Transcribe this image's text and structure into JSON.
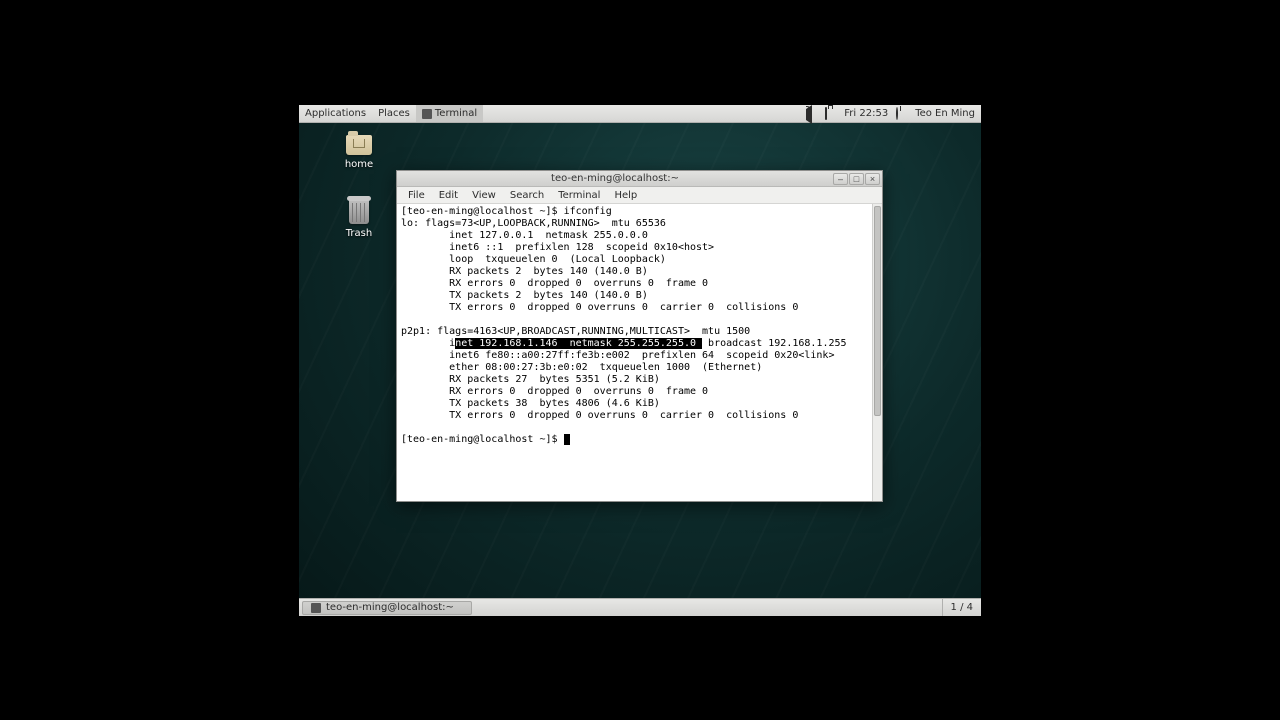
{
  "topbar": {
    "menus": {
      "applications": "Applications",
      "places": "Places"
    },
    "app_launcher": "Terminal",
    "clock": "Fri 22:53",
    "user": "Teo En Ming"
  },
  "desktop_icons": {
    "home": "home",
    "trash": "Trash"
  },
  "window": {
    "title": "teo-en-ming@localhost:~",
    "menus": {
      "file": "File",
      "edit": "Edit",
      "view": "View",
      "search": "Search",
      "terminal": "Terminal",
      "help": "Help"
    },
    "controls": {
      "min": "–",
      "max": "□",
      "close": "×"
    }
  },
  "terminal": {
    "prompt1": "[teo-en-ming@localhost ~]$ ",
    "cmd1": "ifconfig",
    "l1": "lo: flags=73<UP,LOOPBACK,RUNNING>  mtu 65536",
    "l2": "        inet 127.0.0.1  netmask 255.0.0.0",
    "l3": "        inet6 ::1  prefixlen 128  scopeid 0x10<host>",
    "l4": "        loop  txqueuelen 0  (Local Loopback)",
    "l5": "        RX packets 2  bytes 140 (140.0 B)",
    "l6": "        RX errors 0  dropped 0  overruns 0  frame 0",
    "l7": "        TX packets 2  bytes 140 (140.0 B)",
    "l8": "        TX errors 0  dropped 0 overruns 0  carrier 0  collisions 0",
    "l9": "",
    "l10": "p2p1: flags=4163<UP,BROADCAST,RUNNING,MULTICAST>  mtu 1500",
    "l11a": "        i",
    "l11b": "net 192.168.1.146  netmask 255.255.255.0 ",
    "l11c": " broadcast 192.168.1.255",
    "l12": "        inet6 fe80::a00:27ff:fe3b:e002  prefixlen 64  scopeid 0x20<link>",
    "l13": "        ether 08:00:27:3b:e0:02  txqueuelen 1000  (Ethernet)",
    "l14": "        RX packets 27  bytes 5351 (5.2 KiB)",
    "l15": "        RX errors 0  dropped 0  overruns 0  frame 0",
    "l16": "        TX packets 38  bytes 4806 (4.6 KiB)",
    "l17": "        TX errors 0  dropped 0 overruns 0  carrier 0  collisions 0",
    "l18": "",
    "prompt2": "[teo-en-ming@localhost ~]$ "
  },
  "taskbar": {
    "task_label": "teo-en-ming@localhost:~",
    "workspace": "1 / 4"
  }
}
